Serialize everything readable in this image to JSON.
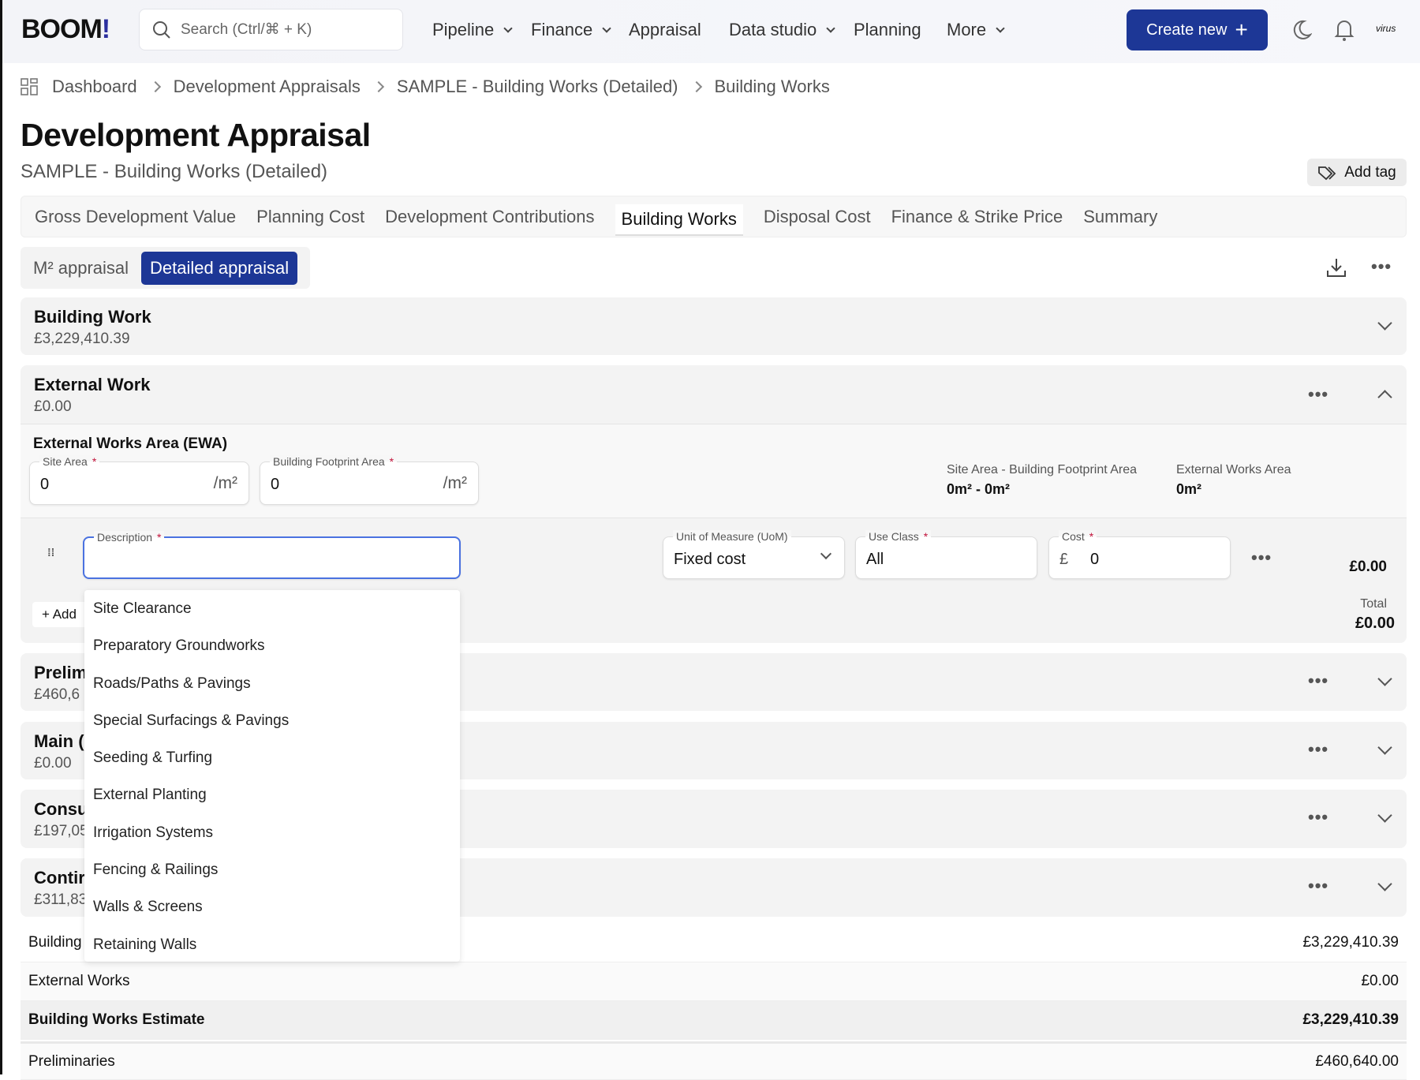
{
  "header": {
    "logo": "BOOM!",
    "search_placeholder": "Search (Ctrl/⌘ + K)",
    "nav": [
      {
        "label": "Pipeline",
        "dropdown": true
      },
      {
        "label": "Finance",
        "dropdown": true
      },
      {
        "label": "Appraisal"
      },
      {
        "label": "Data studio",
        "dropdown": true
      },
      {
        "label": "Planning"
      },
      {
        "label": "More",
        "dropdown": true
      }
    ],
    "create_label": "Create new",
    "avatar_text": "virus",
    "accent": "#1d3796"
  },
  "breadcrumb": [
    "Dashboard",
    "Development Appraisals",
    "SAMPLE - Building Works (Detailed)",
    "Building Works"
  ],
  "page": {
    "title": "Development Appraisal",
    "subtitle": "SAMPLE - Building Works (Detailed)",
    "add_tag": "Add tag"
  },
  "tabs": [
    "Gross Development Value",
    "Planning Cost",
    "Development Contributions",
    "Building Works",
    "Disposal Cost",
    "Finance & Strike Price",
    "Summary"
  ],
  "active_tab": "Building Works",
  "mode": {
    "m2": "M² appraisal",
    "detailed": "Detailed appraisal"
  },
  "sections": [
    {
      "title": "Building Work",
      "value": "£3,229,410.39"
    },
    {
      "title": "External Work",
      "value": "£0.00"
    },
    {
      "title": "Prelim",
      "value": "£460,6"
    },
    {
      "title": "Main (",
      "value": "£0.00"
    },
    {
      "title": "Consu",
      "value": "£197,05"
    },
    {
      "title": "Contir",
      "value": "£311,83"
    }
  ],
  "ewa": {
    "title": "External Works Area (EWA)",
    "site_area_label": "Site Area",
    "site_area": "0",
    "footprint_label": "Building Footprint Area",
    "footprint": "0",
    "unit": "/m²",
    "calc_label": "Site Area - Building Footprint Area",
    "calc_value": "0m² - 0m²",
    "ewa_label": "External Works Area",
    "ewa_value": "0m²"
  },
  "line": {
    "description_label": "Description",
    "uom_label": "Unit of Measure (UoM)",
    "uom": "Fixed cost",
    "use_class_label": "Use Class",
    "use_class": "All",
    "cost_label": "Cost",
    "currency": "£",
    "cost": "0",
    "line_total": "£0.00",
    "add_label": "Add",
    "total_label": "Total",
    "total": "£0.00"
  },
  "dropdown": [
    "Site Clearance",
    "Preparatory Groundworks",
    "Roads/Paths & Pavings",
    "Special Surfacings & Pavings",
    "Seeding & Turfing",
    "External Planting",
    "Irrigation Systems",
    "Fencing & Railings",
    "Walls & Screens",
    "Retaining Walls"
  ],
  "summary": [
    {
      "label": "Building",
      "value": "£3,229,410.39"
    },
    {
      "label": "External Works",
      "value": "£0.00"
    },
    {
      "label": "Building Works Estimate",
      "value": "£3,229,410.39",
      "bold": true
    },
    {
      "label": "Preliminaries",
      "value": "£460,640.00"
    }
  ]
}
